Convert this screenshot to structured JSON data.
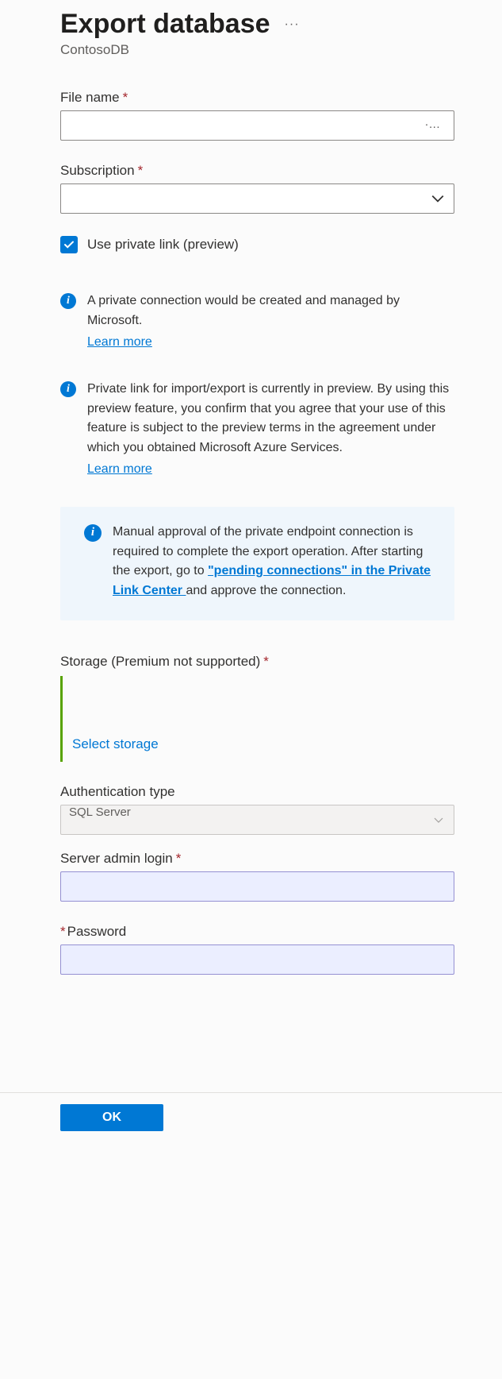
{
  "header": {
    "title": "Export database",
    "subtitle": "ContosoDB"
  },
  "fields": {
    "file_name_label": "File name",
    "file_name_value": "",
    "subscription_label": "Subscription",
    "subscription_value": "",
    "private_link_label": "Use private link (preview)",
    "storage_label": "Storage (Premium not supported)",
    "storage_select_text": "Select storage",
    "auth_type_label": "Authentication type",
    "auth_type_value": "SQL Server",
    "admin_login_label": "Server admin login",
    "admin_login_value": "",
    "password_label": "Password",
    "password_value": ""
  },
  "info": {
    "msg1": "A private connection would be created and managed by Microsoft.",
    "msg1_link": "Learn more",
    "msg2": "Private link for import/export is currently in preview. By using this preview feature, you confirm that you agree that your use of this feature is subject to the preview terms in the agreement under which you obtained Microsoft Azure Services.",
    "msg2_link": "Learn more",
    "callout_prefix": "Manual approval of the private endpoint connection is required to complete the export operation. After starting the export, go to ",
    "callout_link": "\"pending connections\" in the Private Link Center ",
    "callout_suffix": "and approve the connection."
  },
  "buttons": {
    "ok": "OK"
  }
}
